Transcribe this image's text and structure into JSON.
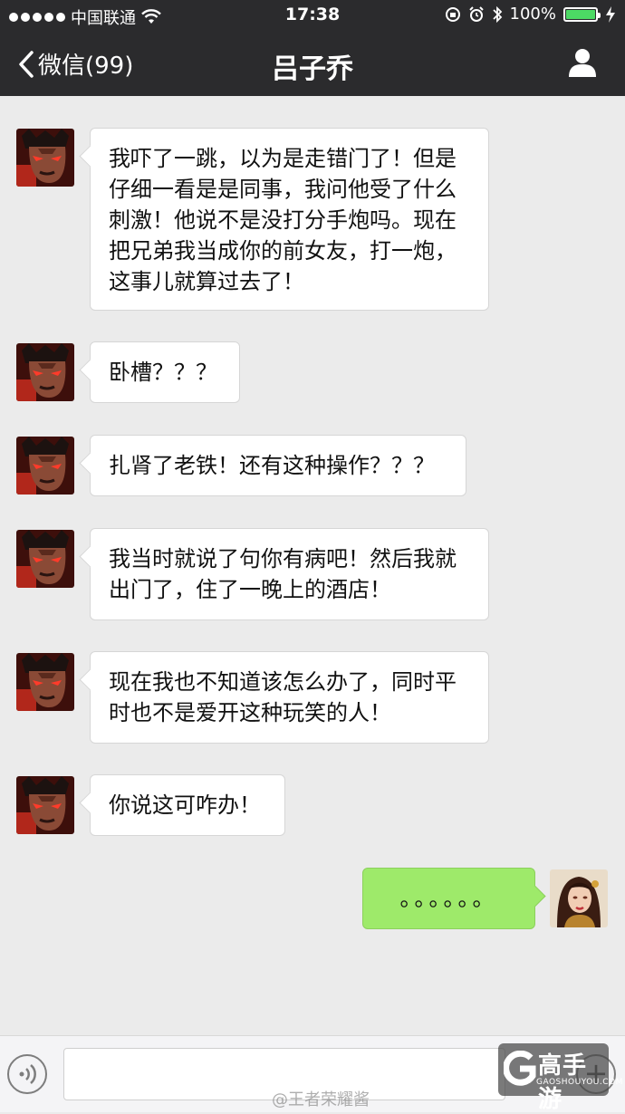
{
  "status_bar": {
    "carrier": "中国联通",
    "time": "17:38",
    "battery_percent": "100%",
    "battery_level": 1.0
  },
  "nav": {
    "back_label": "微信(99)",
    "title": "吕子乔"
  },
  "messages": [
    {
      "side": "left",
      "text_lines": [
        "我吓了一跳，以为是走错门了！但是",
        "仔细一看是是同事，我问他受了什么",
        "刺激！他说不是没打分手炮吗。现在",
        "把兄弟我当成你的前女友，打一炮，",
        "这事儿就算过去了！"
      ]
    },
    {
      "side": "left",
      "text_lines": [
        "卧槽？？？"
      ]
    },
    {
      "side": "left",
      "text_lines": [
        "扎肾了老铁！还有这种操作？？？"
      ]
    },
    {
      "side": "left",
      "text_lines": [
        "我当时就说了句你有病吧！然后我就",
        "出门了，住了一晚上的酒店！"
      ]
    },
    {
      "side": "left",
      "text_lines": [
        "现在我也不知道该怎么办了，同时平",
        "时也不是爱开这种玩笑的人！"
      ]
    },
    {
      "side": "left",
      "text_lines": [
        "你说这可咋办！"
      ]
    },
    {
      "side": "right",
      "text_lines": [
        "。。。。。。"
      ]
    }
  ],
  "watermark": {
    "logo_text": "高手游",
    "logo_subtext": "GAOSHOUYOU.COM",
    "weibo_text": "@王者荣耀酱"
  },
  "colors": {
    "bar_bg": "#2b2b2d",
    "chat_bg": "#ebebeb",
    "sent_bubble": "#9eea6a",
    "received_bubble": "#ffffff",
    "battery_green": "#4cd964"
  }
}
